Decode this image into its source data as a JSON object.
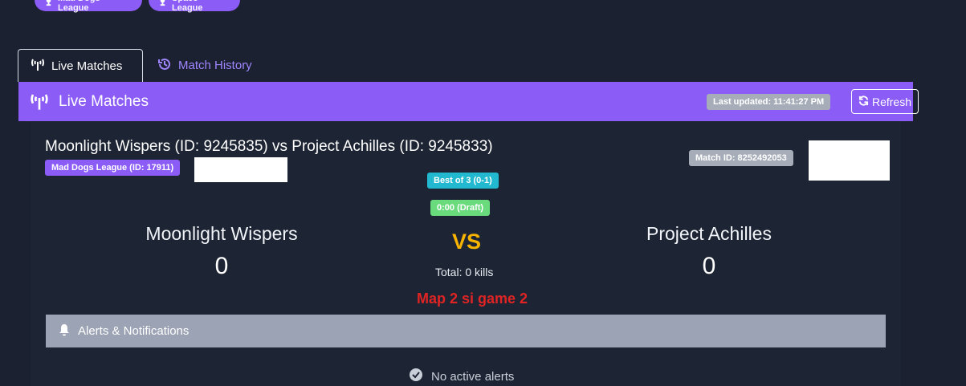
{
  "league_pills": [
    {
      "label": "Mad Dogs League",
      "icon": "trophy-icon"
    },
    {
      "label": "Space League",
      "icon": "trophy-icon"
    }
  ],
  "tabs": [
    {
      "label": "Live Matches",
      "icon": "broadcast-tower-icon",
      "active": true
    },
    {
      "label": "Match History",
      "icon": "history-icon",
      "active": false
    }
  ],
  "header": {
    "title": "Live Matches",
    "last_updated": "Last updated: 11:41:27 PM",
    "refresh_label": "Refresh"
  },
  "match": {
    "title": "Moonlight Wispers (ID: 9245835) vs Project Achilles (ID: 9245833)",
    "league_badge": "Mad Dogs League (ID: 17911)",
    "match_id": "Match ID: 8252492053",
    "series": "Best of 3 (0-1)",
    "clock": "0:00 (Draft)",
    "team_left": {
      "name": "Moonlight Wispers",
      "score": "0"
    },
    "team_right": {
      "name": "Project Achilles",
      "score": "0"
    },
    "vs": "VS",
    "total_kills": "Total: 0 kills",
    "note": "Map 2 si game 2"
  },
  "alerts": {
    "title": "Alerts & Notifications",
    "empty_text": "No active alerts"
  },
  "colors": {
    "accent": "#8b5cf6",
    "background": "#1b2130",
    "series_badge": "#22b8cf",
    "clock_badge": "#69db7c",
    "vs": "#f6b400",
    "note": "#e02424"
  }
}
